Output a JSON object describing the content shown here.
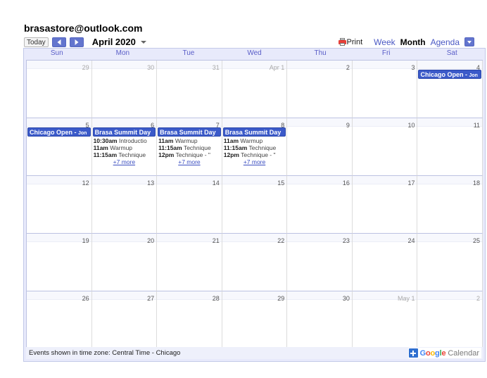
{
  "header": {
    "account": "brasastore@outlook.com",
    "today_label": "Today",
    "prev_icon": "chevron-left-icon",
    "next_icon": "chevron-right-icon",
    "month_label": "April 2020",
    "month_caret_icon": "chevron-down-icon"
  },
  "view_controls": {
    "print_label": "Print",
    "print_icon": "printer-icon",
    "views": [
      {
        "label": "Week",
        "active": false
      },
      {
        "label": "Month",
        "active": true
      },
      {
        "label": "Agenda",
        "active": false
      }
    ],
    "caret_icon": "chevron-down-icon"
  },
  "day_headers": [
    "Sun",
    "Mon",
    "Tue",
    "Wed",
    "Thu",
    "Fri",
    "Sat"
  ],
  "weeks": [
    [
      {
        "num": "29",
        "muted": true,
        "events": []
      },
      {
        "num": "30",
        "muted": true,
        "events": []
      },
      {
        "num": "31",
        "muted": true,
        "events": []
      },
      {
        "num": "Apr 1",
        "muted": true,
        "events": []
      },
      {
        "num": "2",
        "muted": false,
        "events": []
      },
      {
        "num": "3",
        "muted": false,
        "events": []
      },
      {
        "num": "4",
        "muted": false,
        "events": [
          {
            "type": "bar",
            "title": "Chicago Open - ",
            "sub": "Jon"
          }
        ]
      }
    ],
    [
      {
        "num": "5",
        "muted": false,
        "events": [
          {
            "type": "bar",
            "title": "Chicago Open - ",
            "sub": "Jon"
          }
        ]
      },
      {
        "num": "6",
        "muted": false,
        "events": [
          {
            "type": "bar",
            "title": "Brasa Summit Day",
            "sub": ""
          },
          {
            "type": "line",
            "time": "10:30am",
            "name": "Introductio"
          },
          {
            "type": "line",
            "time": "11am",
            "name": "Warmup"
          },
          {
            "type": "line",
            "time": "11:15am",
            "name": "Technique"
          },
          {
            "type": "more",
            "label": "+7 more"
          }
        ]
      },
      {
        "num": "7",
        "muted": false,
        "events": [
          {
            "type": "bar",
            "title": "Brasa Summit Day",
            "sub": ""
          },
          {
            "type": "line",
            "time": "11am",
            "name": "Warmup"
          },
          {
            "type": "line",
            "time": "11:15am",
            "name": "Technique"
          },
          {
            "type": "line",
            "time": "12pm",
            "name": "Technique - \""
          },
          {
            "type": "more",
            "label": "+7 more"
          }
        ]
      },
      {
        "num": "8",
        "muted": false,
        "events": [
          {
            "type": "bar",
            "title": "Brasa Summit Day",
            "sub": ""
          },
          {
            "type": "line",
            "time": "11am",
            "name": "Warmup"
          },
          {
            "type": "line",
            "time": "11:15am",
            "name": "Technique"
          },
          {
            "type": "line",
            "time": "12pm",
            "name": "Technique - \""
          },
          {
            "type": "more",
            "label": "+7 more"
          }
        ]
      },
      {
        "num": "9",
        "muted": false,
        "events": []
      },
      {
        "num": "10",
        "muted": false,
        "events": []
      },
      {
        "num": "11",
        "muted": false,
        "events": []
      }
    ],
    [
      {
        "num": "12",
        "muted": false,
        "events": []
      },
      {
        "num": "13",
        "muted": false,
        "events": []
      },
      {
        "num": "14",
        "muted": false,
        "events": []
      },
      {
        "num": "15",
        "muted": false,
        "events": []
      },
      {
        "num": "16",
        "muted": false,
        "events": []
      },
      {
        "num": "17",
        "muted": false,
        "events": []
      },
      {
        "num": "18",
        "muted": false,
        "events": []
      }
    ],
    [
      {
        "num": "19",
        "muted": false,
        "events": []
      },
      {
        "num": "20",
        "muted": false,
        "events": []
      },
      {
        "num": "21",
        "muted": false,
        "events": []
      },
      {
        "num": "22",
        "muted": false,
        "events": []
      },
      {
        "num": "23",
        "muted": false,
        "events": []
      },
      {
        "num": "24",
        "muted": false,
        "events": []
      },
      {
        "num": "25",
        "muted": false,
        "events": []
      }
    ],
    [
      {
        "num": "26",
        "muted": false,
        "events": []
      },
      {
        "num": "27",
        "muted": false,
        "events": []
      },
      {
        "num": "28",
        "muted": false,
        "events": []
      },
      {
        "num": "29",
        "muted": false,
        "events": []
      },
      {
        "num": "30",
        "muted": false,
        "events": []
      },
      {
        "num": "May 1",
        "muted": true,
        "events": []
      },
      {
        "num": "2",
        "muted": true,
        "events": []
      }
    ]
  ],
  "footer": {
    "timezone_text": "Events shown in time zone: Central Time - Chicago",
    "logo": {
      "plus_icon": "plus-icon",
      "google_letters": [
        "G",
        "o",
        "o",
        "g",
        "l",
        "e"
      ],
      "calendar_word": "Calendar"
    }
  },
  "colors": {
    "event_blue": "#3b5ac9",
    "link_blue": "#4a58c4",
    "frame_lavender": "#e8eafb",
    "dow_text": "#5a5ec8"
  }
}
